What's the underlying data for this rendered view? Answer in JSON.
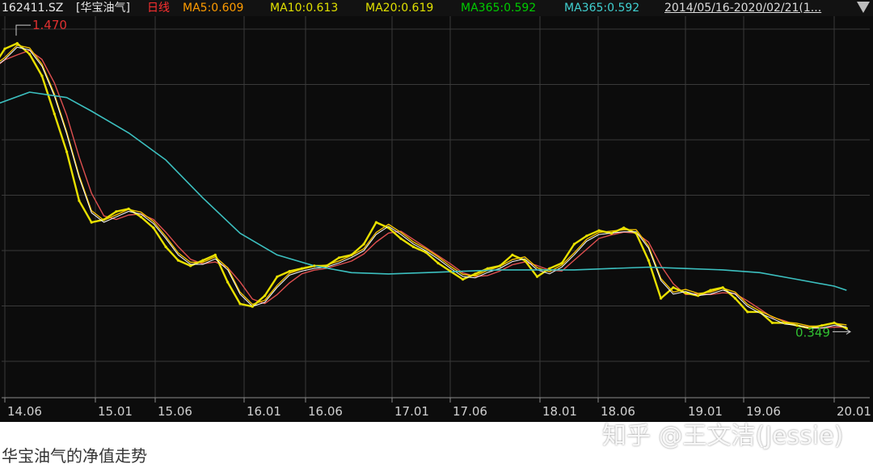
{
  "header": {
    "code": "162411.SZ",
    "name": "[华宝油气]",
    "period": "日线",
    "ma5": "MA5:0.609",
    "ma10": "MA10:0.613",
    "ma20": "MA20:0.619",
    "ma365a": "MA365:0.592",
    "ma365b": "MA365:0.592",
    "range": "2014/05/16-2020/02/21(1..."
  },
  "caption": "华宝油气的净值走势",
  "watermark": "知乎 @王文洁(Jessie)",
  "colors": {
    "background": "#0c0c0c",
    "grid": "#3a3a3a",
    "price": "#e8e000",
    "ma5": "#ffffff",
    "ma10": "#f0c000",
    "ma20": "#e05050",
    "ma365": "#3cc0c0",
    "max_label": "#e03030",
    "min_label": "#30c030",
    "axis_text": "#d0d0d0"
  },
  "chart_data": {
    "type": "line",
    "title": "华宝油气的净值走势",
    "x_tick_labels": [
      "14.06",
      "15.01",
      "15.06",
      "16.01",
      "16.06",
      "17.01",
      "17.06",
      "18.01",
      "18.06",
      "19.01",
      "19.06",
      "20.01"
    ],
    "annotations": {
      "max": "1.470",
      "min": "0.349"
    },
    "series": [
      {
        "name": "净值",
        "x": [
          "14.05",
          "14.06",
          "14.07",
          "14.08",
          "14.09",
          "14.10",
          "14.11",
          "14.12",
          "15.01",
          "15.02",
          "15.03",
          "15.04",
          "15.05",
          "15.06",
          "15.07",
          "15.08",
          "15.09",
          "15.10",
          "15.11",
          "15.12",
          "16.01",
          "16.02",
          "16.03",
          "16.04",
          "16.05",
          "16.06",
          "16.07",
          "16.08",
          "16.09",
          "16.10",
          "16.11",
          "16.12",
          "17.01",
          "17.02",
          "17.03",
          "17.04",
          "17.05",
          "17.06",
          "17.07",
          "17.08",
          "17.09",
          "17.10",
          "17.11",
          "17.12",
          "18.01",
          "18.02",
          "18.03",
          "18.04",
          "18.05",
          "18.06",
          "18.07",
          "18.08",
          "18.09",
          "18.10",
          "18.11",
          "18.12",
          "19.01",
          "19.02",
          "19.03",
          "19.04",
          "19.05",
          "19.06",
          "19.07",
          "19.08",
          "19.09",
          "19.10",
          "19.11",
          "19.12",
          "20.01",
          "20.02"
        ],
        "values": [
          1.31,
          1.38,
          1.4,
          1.36,
          1.28,
          1.14,
          1.0,
          0.82,
          0.74,
          0.75,
          0.78,
          0.79,
          0.76,
          0.72,
          0.65,
          0.6,
          0.58,
          0.6,
          0.62,
          0.52,
          0.44,
          0.43,
          0.47,
          0.54,
          0.56,
          0.57,
          0.58,
          0.58,
          0.61,
          0.62,
          0.66,
          0.74,
          0.72,
          0.68,
          0.65,
          0.63,
          0.59,
          0.56,
          0.53,
          0.55,
          0.57,
          0.58,
          0.62,
          0.6,
          0.54,
          0.57,
          0.59,
          0.66,
          0.69,
          0.71,
          0.7,
          0.72,
          0.7,
          0.6,
          0.46,
          0.5,
          0.48,
          0.47,
          0.49,
          0.5,
          0.46,
          0.41,
          0.41,
          0.37,
          0.37,
          0.36,
          0.35,
          0.36,
          0.37,
          0.349
        ]
      },
      {
        "name": "MA365",
        "x": [
          "14.05",
          "14.08",
          "14.11",
          "15.01",
          "15.04",
          "15.07",
          "15.10",
          "16.01",
          "16.04",
          "16.07",
          "16.10",
          "17.01",
          "17.04",
          "17.07",
          "17.10",
          "18.01",
          "18.04",
          "18.07",
          "18.10",
          "19.01",
          "19.04",
          "19.07",
          "19.10",
          "20.01",
          "20.02"
        ],
        "values": [
          1.17,
          1.22,
          1.2,
          1.15,
          1.07,
          0.97,
          0.83,
          0.7,
          0.62,
          0.58,
          0.555,
          0.55,
          0.555,
          0.56,
          0.565,
          0.565,
          0.565,
          0.57,
          0.575,
          0.57,
          0.565,
          0.555,
          0.53,
          0.505,
          0.49
        ]
      }
    ]
  }
}
